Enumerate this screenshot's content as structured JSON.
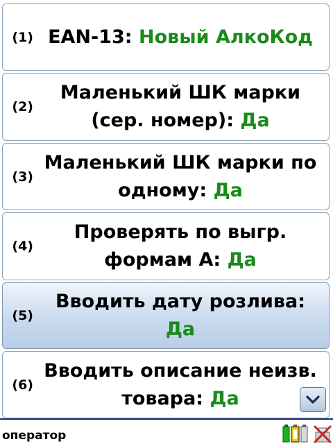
{
  "items": [
    {
      "num": "(1)",
      "line1": "EAN-13: ",
      "value1": "Новый АлкоКод",
      "line2": "",
      "value2": ""
    },
    {
      "num": "(2)",
      "line1": "Маленький ШК марки",
      "value1": "",
      "line2": "(сер. номер): ",
      "value2": "Да"
    },
    {
      "num": "(3)",
      "line1": "Маленький ШК марки по",
      "value1": "",
      "line2": "одному: ",
      "value2": "Да"
    },
    {
      "num": "(4)",
      "line1": "Проверять по выгр.",
      "value1": "",
      "line2": "формам А: ",
      "value2": "Да"
    },
    {
      "num": "(5)",
      "line1": "Вводить дату розлива:",
      "value1": "",
      "line2": "",
      "value2": "Да"
    },
    {
      "num": "(6)",
      "line1": "Вводить описание неизв.",
      "value1": "",
      "line2": "товара: ",
      "value2": "Да"
    }
  ],
  "selected_index": 4,
  "status": {
    "user": "оператор"
  },
  "icons": {
    "scroll": "chevron-down-icon",
    "battery": "battery-icon",
    "network": "network-disconnected-icon"
  },
  "colors": {
    "value": "#1a8a1a",
    "selected_bg": "#c9daee",
    "statusbar_line": "#1c2a6b"
  }
}
